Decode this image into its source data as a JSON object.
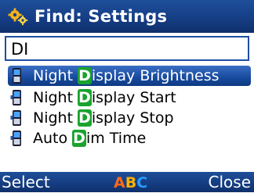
{
  "header": {
    "title": "Find: Settings",
    "icon": "settings-gears-icon"
  },
  "search": {
    "value": "DI"
  },
  "results": [
    {
      "pre": "Night ",
      "match": "D",
      "post": "isplay Brightness",
      "icon": "phone-icon",
      "selected": true
    },
    {
      "pre": "Night ",
      "match": "D",
      "post": "isplay Start",
      "icon": "phone-icon",
      "selected": false
    },
    {
      "pre": "Night ",
      "match": "D",
      "post": "isplay Stop",
      "icon": "phone-icon",
      "selected": false
    },
    {
      "pre": "Auto ",
      "match": "D",
      "post": "im Time",
      "icon": "phone-icon",
      "selected": false
    }
  ],
  "softkeys": {
    "left": "Select",
    "middle": {
      "a": "A",
      "b": "B",
      "c": "C"
    },
    "right": "Close"
  },
  "colors": {
    "titlebar": "#153e85",
    "selection": "#174a9d",
    "match_highlight": "#1aa32e",
    "search_border": "#1e4fa2"
  }
}
